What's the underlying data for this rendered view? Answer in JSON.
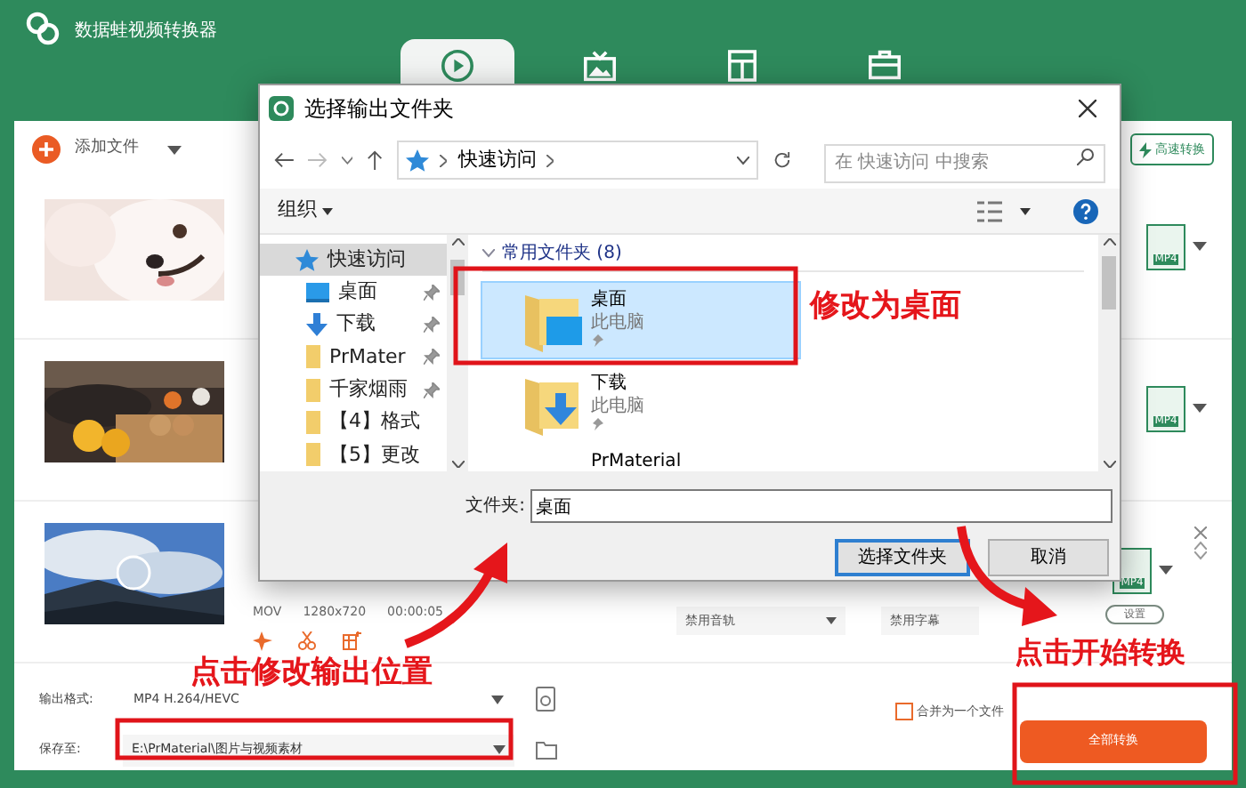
{
  "app": {
    "title": "数据蛙视频转换器"
  },
  "top_tabs": [
    {
      "kind": "convert",
      "selected": true
    },
    {
      "kind": "tv",
      "selected": false
    },
    {
      "kind": "layout",
      "selected": false
    },
    {
      "kind": "toolbox",
      "selected": false
    }
  ],
  "toolbar": {
    "add_files": "添加文件",
    "fast_convert": "高速转换"
  },
  "files": [
    {
      "format_badge": "MP4"
    },
    {
      "format_badge": "MP4"
    },
    {
      "format_badge": "MP4",
      "meta": [
        "MOV",
        "1280x720",
        "00:00:05"
      ],
      "audio": "禁用音轨",
      "subtitle": "禁用字幕",
      "settings": "设置"
    }
  ],
  "dialog": {
    "title": "选择输出文件夹",
    "address": "快速访问",
    "search": {
      "placeholder": "在 快速访问 中搜索"
    },
    "organize": "组织",
    "nav": [
      {
        "label": "快速访问",
        "kind": "star",
        "selected": true,
        "pinned": false
      },
      {
        "label": "桌面",
        "kind": "desktop",
        "selected": false,
        "pinned": true
      },
      {
        "label": "下载",
        "kind": "download",
        "selected": false,
        "pinned": true
      },
      {
        "label": "PrMater",
        "kind": "folder",
        "selected": false,
        "pinned": true
      },
      {
        "label": "千家烟雨",
        "kind": "folder",
        "selected": false,
        "pinned": true
      },
      {
        "label": "【4】格式",
        "kind": "folder",
        "selected": false,
        "pinned": false
      },
      {
        "label": "【5】更改",
        "kind": "folder",
        "selected": false,
        "pinned": false
      }
    ],
    "group": "常用文件夹 (8)",
    "items": [
      {
        "name": "桌面",
        "location": "此电脑",
        "kind": "desktop",
        "selected": true
      },
      {
        "name": "下载",
        "location": "此电脑",
        "kind": "download",
        "selected": false
      },
      {
        "name": "PrMaterial",
        "selected": false
      }
    ],
    "folder_label": "文件夹:",
    "folder_value": "桌面",
    "ok": "选择文件夹",
    "cancel": "取消"
  },
  "bottom": {
    "format_label": "输出格式:",
    "format": "MP4 H.264/HEVC",
    "save_label": "保存至:",
    "save_path": "E:\\PrMaterial\\图片与视频素材",
    "merge": {
      "label": "合并为一个文件",
      "checked": false
    },
    "convert_all": "全部转换"
  },
  "annotations": [
    {
      "text": "修改为桌面"
    },
    {
      "text": "点击修改输出位置"
    },
    {
      "text": "点击开始转换"
    }
  ]
}
